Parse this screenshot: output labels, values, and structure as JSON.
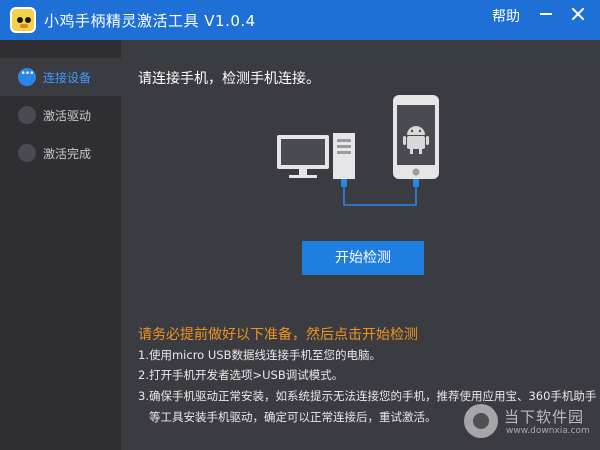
{
  "window": {
    "title": "小鸡手柄精灵激活工具 V1.0.4",
    "help_label": "帮助",
    "logo_icon": "chick-logo-icon",
    "accent_color": "#1e6fd6"
  },
  "sidebar": {
    "items": [
      {
        "label": "连接设备",
        "active": true
      },
      {
        "label": "激活驱动",
        "active": false
      },
      {
        "label": "激活完成",
        "active": false
      }
    ]
  },
  "main": {
    "instruction": "请连接手机，检测手机连接。",
    "illustration_icons": [
      "desktop-computer-icon",
      "smartphone-android-icon",
      "usb-cable-icon"
    ],
    "start_button_label": "开始检测",
    "prep_title": "请务必提前做好以下准备，然后点击开始检测",
    "prep_lines": [
      "1.使用micro USB数据线连接手机至您的电脑。",
      "2.打开手机开发者选项>USB调试模式。",
      "3.确保手机驱动正常安装，如系统提示无法连接您的手机，推荐使用应用宝、360手机助手",
      "等工具安装手机驱动，确定可以正常连接后，重试激活。"
    ]
  },
  "watermark": {
    "text": "当下软件园",
    "url": "www.downxia.com"
  }
}
